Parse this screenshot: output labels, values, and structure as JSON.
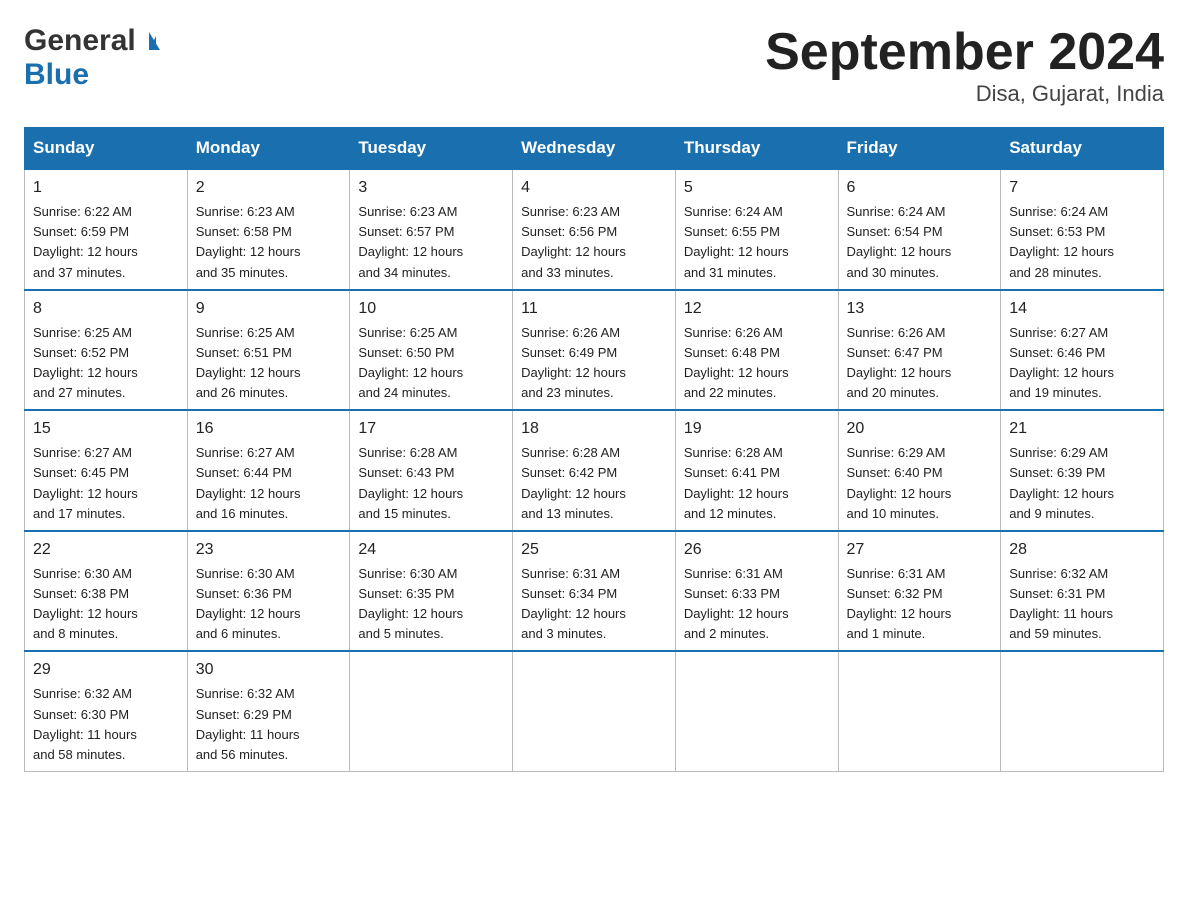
{
  "header": {
    "logo_general": "General",
    "logo_blue": "Blue",
    "title": "September 2024",
    "location": "Disa, Gujarat, India"
  },
  "calendar": {
    "headers": [
      "Sunday",
      "Monday",
      "Tuesday",
      "Wednesday",
      "Thursday",
      "Friday",
      "Saturday"
    ],
    "weeks": [
      [
        {
          "day": "1",
          "sunrise": "6:22 AM",
          "sunset": "6:59 PM",
          "daylight": "12 hours and 37 minutes."
        },
        {
          "day": "2",
          "sunrise": "6:23 AM",
          "sunset": "6:58 PM",
          "daylight": "12 hours and 35 minutes."
        },
        {
          "day": "3",
          "sunrise": "6:23 AM",
          "sunset": "6:57 PM",
          "daylight": "12 hours and 34 minutes."
        },
        {
          "day": "4",
          "sunrise": "6:23 AM",
          "sunset": "6:56 PM",
          "daylight": "12 hours and 33 minutes."
        },
        {
          "day": "5",
          "sunrise": "6:24 AM",
          "sunset": "6:55 PM",
          "daylight": "12 hours and 31 minutes."
        },
        {
          "day": "6",
          "sunrise": "6:24 AM",
          "sunset": "6:54 PM",
          "daylight": "12 hours and 30 minutes."
        },
        {
          "day": "7",
          "sunrise": "6:24 AM",
          "sunset": "6:53 PM",
          "daylight": "12 hours and 28 minutes."
        }
      ],
      [
        {
          "day": "8",
          "sunrise": "6:25 AM",
          "sunset": "6:52 PM",
          "daylight": "12 hours and 27 minutes."
        },
        {
          "day": "9",
          "sunrise": "6:25 AM",
          "sunset": "6:51 PM",
          "daylight": "12 hours and 26 minutes."
        },
        {
          "day": "10",
          "sunrise": "6:25 AM",
          "sunset": "6:50 PM",
          "daylight": "12 hours and 24 minutes."
        },
        {
          "day": "11",
          "sunrise": "6:26 AM",
          "sunset": "6:49 PM",
          "daylight": "12 hours and 23 minutes."
        },
        {
          "day": "12",
          "sunrise": "6:26 AM",
          "sunset": "6:48 PM",
          "daylight": "12 hours and 22 minutes."
        },
        {
          "day": "13",
          "sunrise": "6:26 AM",
          "sunset": "6:47 PM",
          "daylight": "12 hours and 20 minutes."
        },
        {
          "day": "14",
          "sunrise": "6:27 AM",
          "sunset": "6:46 PM",
          "daylight": "12 hours and 19 minutes."
        }
      ],
      [
        {
          "day": "15",
          "sunrise": "6:27 AM",
          "sunset": "6:45 PM",
          "daylight": "12 hours and 17 minutes."
        },
        {
          "day": "16",
          "sunrise": "6:27 AM",
          "sunset": "6:44 PM",
          "daylight": "12 hours and 16 minutes."
        },
        {
          "day": "17",
          "sunrise": "6:28 AM",
          "sunset": "6:43 PM",
          "daylight": "12 hours and 15 minutes."
        },
        {
          "day": "18",
          "sunrise": "6:28 AM",
          "sunset": "6:42 PM",
          "daylight": "12 hours and 13 minutes."
        },
        {
          "day": "19",
          "sunrise": "6:28 AM",
          "sunset": "6:41 PM",
          "daylight": "12 hours and 12 minutes."
        },
        {
          "day": "20",
          "sunrise": "6:29 AM",
          "sunset": "6:40 PM",
          "daylight": "12 hours and 10 minutes."
        },
        {
          "day": "21",
          "sunrise": "6:29 AM",
          "sunset": "6:39 PM",
          "daylight": "12 hours and 9 minutes."
        }
      ],
      [
        {
          "day": "22",
          "sunrise": "6:30 AM",
          "sunset": "6:38 PM",
          "daylight": "12 hours and 8 minutes."
        },
        {
          "day": "23",
          "sunrise": "6:30 AM",
          "sunset": "6:36 PM",
          "daylight": "12 hours and 6 minutes."
        },
        {
          "day": "24",
          "sunrise": "6:30 AM",
          "sunset": "6:35 PM",
          "daylight": "12 hours and 5 minutes."
        },
        {
          "day": "25",
          "sunrise": "6:31 AM",
          "sunset": "6:34 PM",
          "daylight": "12 hours and 3 minutes."
        },
        {
          "day": "26",
          "sunrise": "6:31 AM",
          "sunset": "6:33 PM",
          "daylight": "12 hours and 2 minutes."
        },
        {
          "day": "27",
          "sunrise": "6:31 AM",
          "sunset": "6:32 PM",
          "daylight": "12 hours and 1 minute."
        },
        {
          "day": "28",
          "sunrise": "6:32 AM",
          "sunset": "6:31 PM",
          "daylight": "11 hours and 59 minutes."
        }
      ],
      [
        {
          "day": "29",
          "sunrise": "6:32 AM",
          "sunset": "6:30 PM",
          "daylight": "11 hours and 58 minutes."
        },
        {
          "day": "30",
          "sunrise": "6:32 AM",
          "sunset": "6:29 PM",
          "daylight": "11 hours and 56 minutes."
        },
        null,
        null,
        null,
        null,
        null
      ]
    ]
  },
  "labels": {
    "sunrise": "Sunrise:",
    "sunset": "Sunset:",
    "daylight": "Daylight:"
  }
}
